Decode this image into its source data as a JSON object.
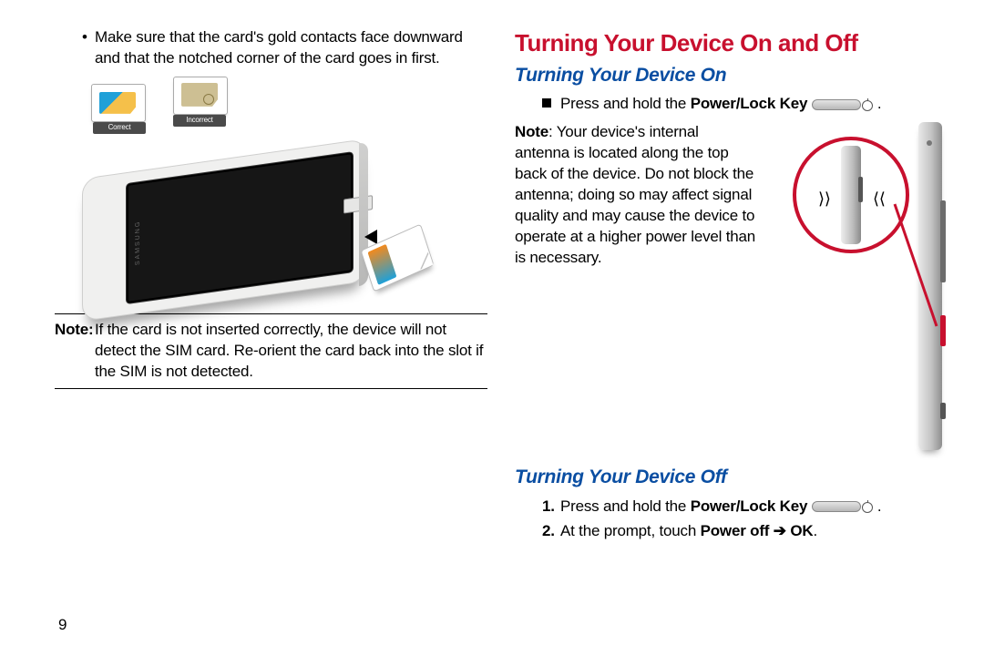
{
  "left": {
    "bullet": "Make sure that the card's gold contacts face downward and that the notched corner of the card goes in first.",
    "labels": {
      "correct": "Correct",
      "incorrect": "Incorrect",
      "brand": "SAMSUNG"
    },
    "note_label": "Note:",
    "note_body": "If the card is not inserted correctly, the device will not detect the SIM card. Re-orient the card back into the slot if the SIM is not detected."
  },
  "right": {
    "h1": "Turning Your Device On and Off",
    "on": {
      "h2": "Turning Your Device On",
      "step_prefix": "Press and hold the ",
      "step_bold": "Power/Lock Key",
      "note_label": "Note",
      "note_body": ": Your device's internal antenna is located along the top back of the device. Do not block the antenna; doing so may affect signal quality and may cause the device to operate at a higher power level than is necessary."
    },
    "off": {
      "h2": "Turning Your Device Off",
      "n1_prefix": "Press and hold the ",
      "n1_bold": "Power/Lock Key",
      "n2_prefix": "At the prompt, touch ",
      "n2_bold1": "Power off",
      "n2_arrow": " ➔ ",
      "n2_bold2": "OK",
      "n1": "1.",
      "n2": "2."
    }
  },
  "page_number": "9"
}
